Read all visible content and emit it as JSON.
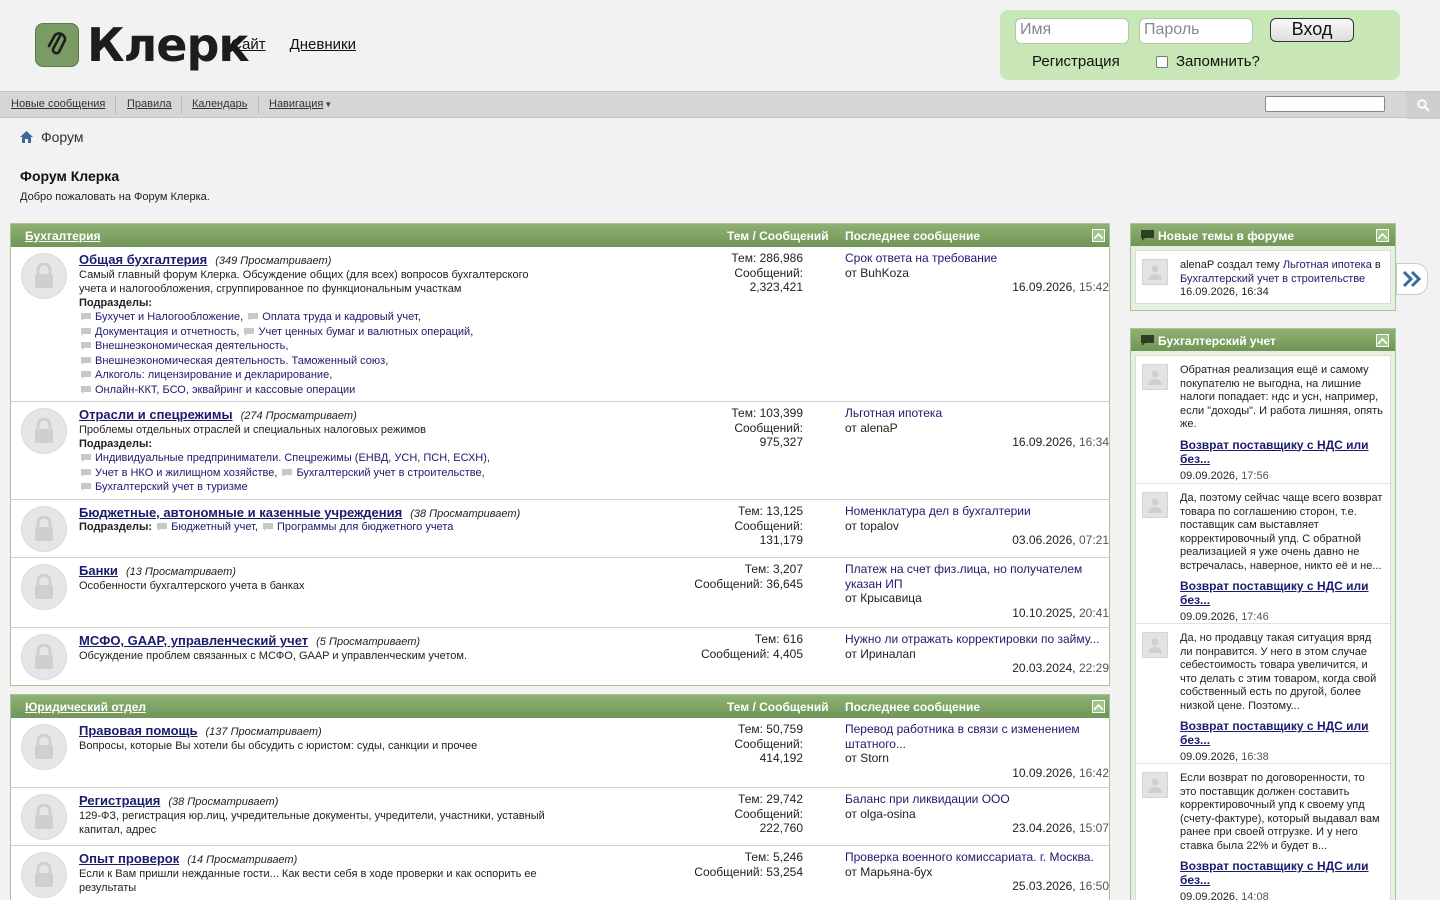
{
  "header": {
    "logo_text": "Клерк",
    "links": [
      "Сайт",
      "Дневники"
    ]
  },
  "login": {
    "username_placeholder": "Имя",
    "password_placeholder": "Пароль",
    "submit_label": "Вход",
    "register_label": "Регистрация",
    "remember_label": "Запомнить?"
  },
  "navbar": {
    "items": [
      "Новые сообщения",
      "Правила",
      "Календарь",
      "Навигация"
    ]
  },
  "breadcrumb": {
    "label": "Форум"
  },
  "page": {
    "title": "Форум Клерка",
    "welcome": "Добро пожаловать на Форум Клерка."
  },
  "columns": {
    "threads_posts": "Тем / Сообщений",
    "last_post": "Последнее сообщение"
  },
  "categories": [
    {
      "name": "Бухгалтерия",
      "forums": [
        {
          "title": "Общая бухгалтерия",
          "viewing": "(349 Просматривает)",
          "desc": "Самый главный форум Клерка. Обсуждение общих (для всех) вопросов бухгалтерского учета и налогообложения, сгруппированное по функциональным участкам",
          "sub_label": "Подразделы:",
          "subforums": [
            "Бухучет и Налогообложение",
            "Оплата труда и кадровый учет",
            "Документация и отчетность",
            "Учет ценных бумаг и валютных операций",
            "Внешнеэкономическая деятельность",
            "Внешнеэкономическая деятельность. Таможенный союз",
            "Алкоголь: лицензирование и декларирование",
            "Онлайн-ККТ, БСО, эквайринг и кассовые операции"
          ],
          "threads": "Тем: 286,986",
          "posts_label": "Сообщений:",
          "posts": "2,323,421",
          "last_title": "Срок ответа на требование",
          "last_by": "от BuhKoza",
          "last_date": "16.09.2026,",
          "last_time": "15:42"
        },
        {
          "title": "Отрасли и спецрежимы",
          "viewing": "(274 Просматривает)",
          "desc": "Проблемы отдельных отраслей и специальных налоговых режимов",
          "sub_label": "Подразделы:",
          "subforums": [
            "Индивидуальные предприниматели. Спецрежимы (ЕНВД, УСН, ПСН, ЕСХН)",
            "Учет в НКО и жилищном хозяйстве",
            "Бухгалтерский учет в строительстве",
            "Бухгалтерский учет в туризме"
          ],
          "threads": "Тем: 103,399",
          "posts_label": "Сообщений:",
          "posts": "975,327",
          "last_title": "Льготная ипотека",
          "last_by": "от alenaP",
          "last_date": "16.09.2026,",
          "last_time": "16:34"
        },
        {
          "title": "Бюджетные, автономные и казенные учреждения",
          "viewing": "(38 Просматривает)",
          "sub_label": "Подразделы:",
          "subforums": [
            "Бюджетный учет",
            "Программы для бюджетного учета"
          ],
          "threads": "Тем: 13,125",
          "posts_label": "Сообщений:",
          "posts": "131,179",
          "last_title": "Номенклатура дел в бухгалтерии",
          "last_by": "от topalov",
          "last_date": "03.06.2026,",
          "last_time": "07:21"
        },
        {
          "title": "Банки",
          "viewing": "(13 Просматривает)",
          "desc": "Особенности бухгалтерского учета в банках",
          "threads": "Тем: 3,207",
          "posts_inline": "Сообщений: 36,645",
          "last_title": "Платеж на счет физ.лица, но получателем указан ИП",
          "last_by": "от Крысавица",
          "last_date": "10.10.2025,",
          "last_time": "20:41"
        },
        {
          "title": "МСФО, GAAP, управленческий учет",
          "viewing": "(5 Просматривает)",
          "desc": "Обсуждение проблем связанных с МСФО, GAAP и управленческим учетом.",
          "threads": "Тем: 616",
          "posts_inline": "Сообщений: 4,405",
          "last_title": "Нужно ли отражать корректировки по займу...",
          "last_by": "от Ириналап",
          "last_date": "20.03.2024,",
          "last_time": "22:29"
        }
      ]
    },
    {
      "name": "Юридический отдел",
      "forums": [
        {
          "title": "Правовая помощь",
          "viewing": "(137 Просматривает)",
          "desc": "Вопросы, которые Вы хотели бы обсудить с юристом: суды, санкции и прочее",
          "threads": "Тем: 50,759",
          "posts_label": "Сообщений:",
          "posts": "414,192",
          "last_title": "Перевод работника в связи с изменением штатного...",
          "last_by": "от Storn",
          "last_date": "10.09.2026,",
          "last_time": "16:42"
        },
        {
          "title": "Регистрация",
          "viewing": "(38 Просматривает)",
          "desc": "129-ФЗ, регистрация юр.лиц, учредительные документы, учредители, участники, уставный капитал, адрес",
          "threads": "Тем: 29,742",
          "posts_label": "Сообщений:",
          "posts": "222,760",
          "last_title": "Баланс при ликвидации ООО",
          "last_by": "от olga-osina",
          "last_date": "23.04.2026,",
          "last_time": "15:07"
        },
        {
          "title": "Опыт проверок",
          "viewing": "(14 Просматривает)",
          "desc": "Если к Вам пришли нежданные гости... Как вести себя в ходе проверки и как оспорить ее результаты",
          "threads": "Тем: 5,246",
          "posts_inline": "Сообщений: 53,254",
          "last_title": "Проверка военного комиссариата. г. Москва.",
          "last_by": "от Марьяна-бух",
          "last_date": "25.03.2026,",
          "last_time": "16:50"
        }
      ]
    }
  ],
  "sidebar": {
    "new_topics": {
      "title": "Новые темы в форуме",
      "entry": {
        "user": "alenaP",
        "verb": " создал тему ",
        "topic": "Льготная ипотека",
        "in": " в ",
        "forum": "Бухгалтерский учет в строительстве",
        "date": "16.09.2026,",
        "time": "16:34"
      }
    },
    "accounting": {
      "title": "Бухгалтерский учет",
      "entries": [
        {
          "text": "Обратная реализация ещё и самому покупателю не выгодна, на лишние налоги попадает: ндс и усн, например, если \"доходы\". И работа лишняя, опять же.",
          "link": "Возврат поставщику с НДС или без...",
          "date": "09.09.2026,",
          "time": "17:56"
        },
        {
          "text": "Да, поэтому сейчас чаще всего возврат товара по соглашению сторон, т.е. поставщик сам выставляет корректировочный упд. С обратной реализацией я уже очень давно не встречалась, наверное, никто её и не...",
          "link": "Возврат поставщику с НДС или без...",
          "date": "09.09.2026,",
          "time": "17:46"
        },
        {
          "text": "Да, но продавцу такая ситуация вряд ли понравится. У него в этом случае себестоимость товара увеличится, и что делать с этим товаром, когда свой собственный есть по другой, более низкой цене. Поэтому...",
          "link": "Возврат поставщику с НДС или без...",
          "date": "09.09.2026,",
          "time": "16:38"
        },
        {
          "text": "Если возврат по договоренности, то это поставщик должен составить корректировочный упд к своему упд (счету-фактуре), который выдавал вам ранее при своей отгрузке. И у него ставка была 22% и будет в...",
          "link": "Возврат поставщику с НДС или без...",
          "date": "09.09.2026,",
          "time": "14:08"
        }
      ]
    }
  }
}
